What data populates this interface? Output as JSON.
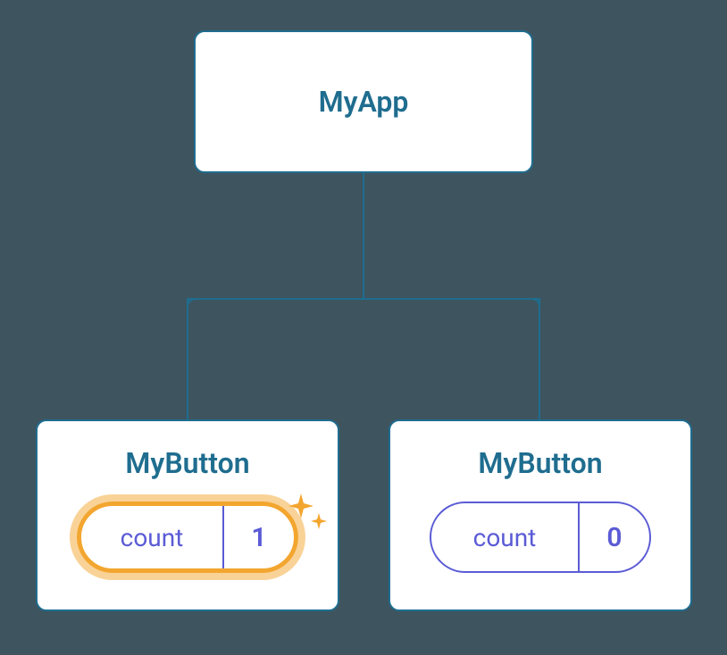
{
  "diagram": {
    "root": {
      "label": "MyApp"
    },
    "children": [
      {
        "label": "MyButton",
        "state": {
          "key": "count",
          "value": "1"
        },
        "highlighted": true
      },
      {
        "label": "MyButton",
        "state": {
          "key": "count",
          "value": "0"
        },
        "highlighted": false
      }
    ]
  }
}
